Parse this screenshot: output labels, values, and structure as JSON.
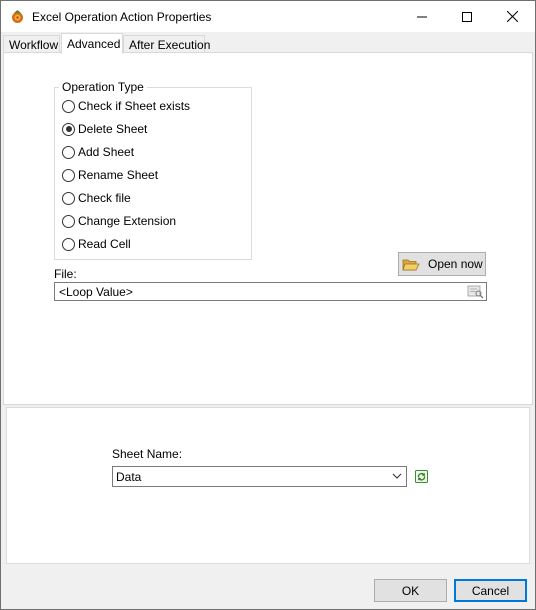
{
  "window": {
    "title": "Excel Operation Action Properties",
    "controls": {
      "minimize_icon": "minimize-icon",
      "maximize_icon": "maximize-icon",
      "close_icon": "close-icon"
    }
  },
  "tabs": [
    {
      "label": "Workflow",
      "active": false
    },
    {
      "label": "Advanced",
      "active": true
    },
    {
      "label": "After Execution",
      "active": false
    }
  ],
  "operation_type": {
    "legend": "Operation Type",
    "options": [
      {
        "label": "Check if Sheet exists",
        "checked": false
      },
      {
        "label": "Delete Sheet",
        "checked": true
      },
      {
        "label": "Add Sheet",
        "checked": false
      },
      {
        "label": "Rename Sheet",
        "checked": false
      },
      {
        "label": "Check file",
        "checked": false
      },
      {
        "label": "Change Extension",
        "checked": false
      },
      {
        "label": "Read Cell",
        "checked": false
      }
    ]
  },
  "open_now": {
    "label": "Open now",
    "icon": "folder-open-icon"
  },
  "file": {
    "label": "File:",
    "value": "<Loop Value>",
    "icon": "browse-icon"
  },
  "sheet": {
    "label": "Sheet Name:",
    "value": "Data",
    "refresh_icon": "refresh-icon"
  },
  "buttons": {
    "ok": "OK",
    "cancel": "Cancel"
  },
  "colors": {
    "focus_border": "#0078d7",
    "button_face": "#e1e1e1",
    "dialog_bg": "#f0f0f0"
  }
}
